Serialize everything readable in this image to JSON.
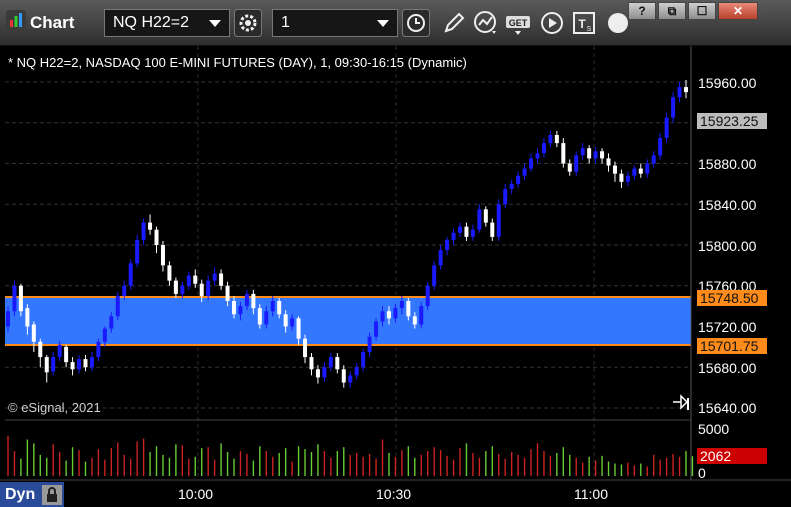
{
  "window": {
    "title": "Chart",
    "symbol": "NQ H22=2",
    "interval": "1",
    "buttons": [
      "?",
      "⧉",
      "☐",
      "✕"
    ]
  },
  "chart": {
    "info_line": "* NQ H22=2, NASDAQ 100 E-MINI FUTURES (DAY), 1, 09:30-16:15 (Dynamic)",
    "copyright": "© eSignal, 2021",
    "y_ticks": [
      "15960.00",
      "15880.00",
      "15840.00",
      "15800.00",
      "15760.00",
      "15720.00",
      "15680.00",
      "15640.00"
    ],
    "x_ticks": [
      "10:00",
      "10:30",
      "11:00"
    ],
    "last_price": "15923.25",
    "band_upper": "15748.50",
    "band_lower": "15701.75",
    "volume_ticks": [
      "5000",
      "0"
    ],
    "last_volume": "2062",
    "mode": "Dyn",
    "colors": {
      "up": "#ffffff",
      "down": "#1a1aff",
      "band": "#3377ff",
      "band_edge": "#ff8c1a",
      "vol_up": "#66cc33",
      "vol_down": "#cc2222"
    }
  },
  "chart_data": {
    "type": "candlestick",
    "price_range": [
      15640,
      15960
    ],
    "x_labels": [
      "10:00",
      "10:30",
      "11:00"
    ],
    "candles": [
      [
        15735,
        15720,
        15740,
        15715
      ],
      [
        15760,
        15735,
        15765,
        15730
      ],
      [
        15735,
        15760,
        15762,
        15730
      ],
      [
        15720,
        15738,
        15742,
        15712
      ],
      [
        15705,
        15722,
        15725,
        15695
      ],
      [
        15690,
        15705,
        15708,
        15680
      ],
      [
        15675,
        15690,
        15692,
        15665
      ],
      [
        15690,
        15676,
        15695,
        15672
      ],
      [
        15702,
        15690,
        15706,
        15686
      ],
      [
        15685,
        15700,
        15702,
        15680
      ],
      [
        15678,
        15685,
        15690,
        15672
      ],
      [
        15688,
        15678,
        15692,
        15674
      ],
      [
        15680,
        15688,
        15692,
        15676
      ],
      [
        15690,
        15680,
        15695,
        15676
      ],
      [
        15705,
        15690,
        15708,
        15686
      ],
      [
        15718,
        15705,
        15720,
        15700
      ],
      [
        15730,
        15718,
        15734,
        15714
      ],
      [
        15750,
        15730,
        15754,
        15726
      ],
      [
        15760,
        15750,
        15765,
        15746
      ],
      [
        15782,
        15760,
        15786,
        15756
      ],
      [
        15805,
        15782,
        15810,
        15778
      ],
      [
        15822,
        15805,
        15826,
        15800
      ],
      [
        15815,
        15822,
        15830,
        15810
      ],
      [
        15800,
        15815,
        15818,
        15792
      ],
      [
        15780,
        15800,
        15804,
        15774
      ],
      [
        15765,
        15780,
        15784,
        15760
      ],
      [
        15752,
        15765,
        15768,
        15748
      ],
      [
        15760,
        15752,
        15764,
        15748
      ],
      [
        15770,
        15760,
        15774,
        15756
      ],
      [
        15762,
        15770,
        15776,
        15758
      ],
      [
        15750,
        15762,
        15766,
        15744
      ],
      [
        15765,
        15750,
        15770,
        15746
      ],
      [
        15772,
        15765,
        15778,
        15760
      ],
      [
        15760,
        15772,
        15776,
        15756
      ],
      [
        15745,
        15760,
        15764,
        15740
      ],
      [
        15732,
        15745,
        15750,
        15728
      ],
      [
        15740,
        15732,
        15744,
        15726
      ],
      [
        15752,
        15740,
        15756,
        15736
      ],
      [
        15738,
        15752,
        15756,
        15732
      ],
      [
        15722,
        15738,
        15742,
        15718
      ],
      [
        15735,
        15722,
        15740,
        15718
      ],
      [
        15745,
        15735,
        15750,
        15730
      ],
      [
        15732,
        15745,
        15748,
        15728
      ],
      [
        15720,
        15732,
        15736,
        15714
      ],
      [
        15728,
        15720,
        15732,
        15716
      ],
      [
        15708,
        15728,
        15730,
        15702
      ],
      [
        15690,
        15708,
        15712,
        15684
      ],
      [
        15678,
        15690,
        15694,
        15672
      ],
      [
        15670,
        15678,
        15682,
        15664
      ],
      [
        15680,
        15670,
        15685,
        15666
      ],
      [
        15690,
        15680,
        15694,
        15676
      ],
      [
        15678,
        15690,
        15694,
        15674
      ],
      [
        15665,
        15678,
        15682,
        15660
      ],
      [
        15672,
        15665,
        15676,
        15660
      ],
      [
        15680,
        15672,
        15684,
        15668
      ],
      [
        15695,
        15680,
        15698,
        15676
      ],
      [
        15710,
        15695,
        15714,
        15690
      ],
      [
        15725,
        15710,
        15728,
        15706
      ],
      [
        15735,
        15725,
        15740,
        15720
      ],
      [
        15728,
        15735,
        15740,
        15722
      ],
      [
        15738,
        15728,
        15742,
        15724
      ],
      [
        15745,
        15738,
        15750,
        15732
      ],
      [
        15730,
        15745,
        15748,
        15726
      ],
      [
        15722,
        15730,
        15734,
        15718
      ],
      [
        15740,
        15722,
        15744,
        15718
      ],
      [
        15760,
        15740,
        15764,
        15736
      ],
      [
        15780,
        15760,
        15784,
        15756
      ],
      [
        15795,
        15780,
        15800,
        15776
      ],
      [
        15805,
        15795,
        15808,
        15790
      ],
      [
        15812,
        15805,
        15816,
        15800
      ],
      [
        15818,
        15812,
        15822,
        15808
      ],
      [
        15808,
        15818,
        15822,
        15804
      ],
      [
        15815,
        15808,
        15820,
        15804
      ],
      [
        15835,
        15815,
        15840,
        15812
      ],
      [
        15822,
        15835,
        15838,
        15818
      ],
      [
        15808,
        15822,
        15826,
        15804
      ],
      [
        15840,
        15808,
        15845,
        15804
      ],
      [
        15855,
        15840,
        15860,
        15836
      ],
      [
        15860,
        15855,
        15864,
        15850
      ],
      [
        15868,
        15860,
        15872,
        15856
      ],
      [
        15875,
        15868,
        15880,
        15864
      ],
      [
        15885,
        15875,
        15890,
        15872
      ],
      [
        15890,
        15885,
        15895,
        15880
      ],
      [
        15900,
        15890,
        15905,
        15886
      ],
      [
        15908,
        15900,
        15912,
        15896
      ],
      [
        15900,
        15908,
        15912,
        15896
      ],
      [
        15880,
        15900,
        15905,
        15876
      ],
      [
        15872,
        15880,
        15884,
        15868
      ],
      [
        15888,
        15872,
        15892,
        15868
      ],
      [
        15895,
        15888,
        15900,
        15884
      ],
      [
        15885,
        15895,
        15898,
        15880
      ],
      [
        15892,
        15885,
        15896,
        15880
      ],
      [
        15885,
        15892,
        15895,
        15880
      ],
      [
        15878,
        15885,
        15890,
        15872
      ],
      [
        15870,
        15878,
        15882,
        15862
      ],
      [
        15862,
        15870,
        15874,
        15856
      ],
      [
        15868,
        15862,
        15872,
        15858
      ],
      [
        15875,
        15868,
        15878,
        15864
      ],
      [
        15870,
        15875,
        15880,
        15866
      ],
      [
        15880,
        15870,
        15884,
        15866
      ],
      [
        15888,
        15880,
        15892,
        15876
      ],
      [
        15905,
        15888,
        15910,
        15884
      ],
      [
        15925,
        15905,
        15930,
        15900
      ],
      [
        15945,
        15925,
        15950,
        15920
      ],
      [
        15955,
        15945,
        15960,
        15940
      ],
      [
        15950,
        15955,
        15962,
        15944
      ]
    ],
    "volume": [
      4200,
      2600,
      1800,
      3800,
      3400,
      2200,
      1900,
      3300,
      2500,
      1600,
      3000,
      2700,
      1500,
      1900,
      2800,
      1700,
      2900,
      3500,
      2200,
      1800,
      3600,
      3900,
      2500,
      3100,
      2200,
      1900,
      3300,
      3200,
      1800,
      2000,
      2900,
      3000,
      1700,
      3400,
      2500,
      1800,
      2600,
      2300,
      1600,
      3100,
      2600,
      2000,
      2400,
      2900,
      1500,
      3100,
      2800,
      2500,
      3300,
      2600,
      1900,
      2600,
      3000,
      2200,
      2400,
      2000,
      2300,
      1800,
      3800,
      2400,
      2000,
      2700,
      3100,
      1900,
      2200,
      2600,
      3000,
      2700,
      2100,
      1700,
      2900,
      3400,
      2400,
      1900,
      2600,
      3100,
      2300,
      1800,
      2500,
      2200,
      1900,
      2800,
      3400,
      2600,
      2100,
      2400,
      3000,
      2200,
      1900,
      1400,
      2000,
      1600,
      2100,
      1500,
      1300,
      1200,
      1400,
      1100,
      1300,
      1000,
      2200,
      1700,
      1900,
      2300,
      2000,
      2600,
      2062
    ]
  }
}
